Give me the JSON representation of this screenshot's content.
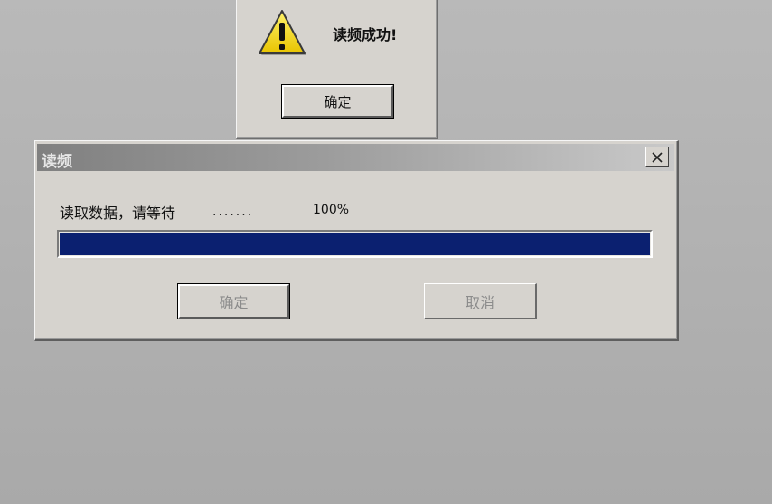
{
  "message_box": {
    "icon": "warning-icon",
    "text": "读频成功!",
    "ok_label": "确定"
  },
  "dialog": {
    "title": "读频",
    "close_icon": "close-icon",
    "status_text": "读取数据，请等待",
    "dots": ".......",
    "percent_text": "100%",
    "progress": 1.0,
    "ok_label": "确定",
    "cancel_label": "取消"
  },
  "colors": {
    "progress_fill": "#0b2070",
    "dialog_face": "#d6d3ce",
    "warning_yellow": "#f5d800"
  }
}
